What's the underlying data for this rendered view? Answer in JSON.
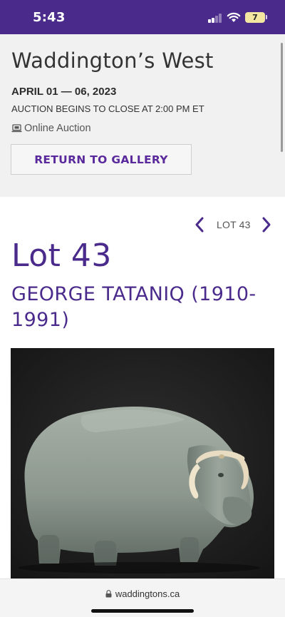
{
  "status_bar": {
    "time": "5:43",
    "battery": "7",
    "icons": [
      "signal-icon",
      "wifi-icon",
      "battery-icon"
    ]
  },
  "auction": {
    "title": "Waddington’s West",
    "dates": "APRIL 01 — 06, 2023",
    "close_info": "AUCTION BEGINS TO CLOSE AT 2:00 PM ET",
    "type": "Online Auction",
    "type_icon": "laptop-icon",
    "return_button": "RETURN TO GALLERY"
  },
  "lot_nav": {
    "label": "LOT 43",
    "prev_icon": "chevron-left-icon",
    "next_icon": "chevron-right-icon"
  },
  "lot": {
    "title": "Lot 43",
    "artist": "GEORGE TATANIQ (1910-1991)",
    "image_subject": "carved stone muskox sculpture"
  },
  "browser": {
    "url": "waddingtons.ca",
    "url_icon": "lock-icon"
  },
  "colors": {
    "brand_purple": "#4a2b8c",
    "button_text": "#5a2a9c",
    "header_bg": "#f1f1f1"
  }
}
